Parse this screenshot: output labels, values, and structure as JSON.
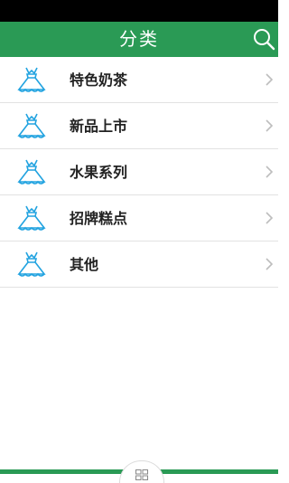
{
  "header": {
    "title": "分类",
    "search_icon": "search-icon",
    "color": "#2a9a55"
  },
  "categories": [
    {
      "label": "特色奶茶",
      "icon": "dress-icon"
    },
    {
      "label": "新品上市",
      "icon": "dress-icon"
    },
    {
      "label": "水果系列",
      "icon": "dress-icon"
    },
    {
      "label": "招牌糕点",
      "icon": "dress-icon"
    },
    {
      "label": "其他",
      "icon": "dress-icon"
    }
  ],
  "bottom_nav": {
    "icon": "grid-icon"
  }
}
